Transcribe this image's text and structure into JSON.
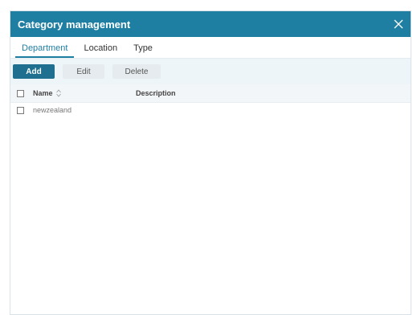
{
  "dialog": {
    "title": "Category management",
    "close_icon": "close-icon"
  },
  "tabs": [
    {
      "label": "Department",
      "active": true
    },
    {
      "label": "Location",
      "active": false
    },
    {
      "label": "Type",
      "active": false
    }
  ],
  "toolbar": {
    "add_label": "Add",
    "edit_label": "Edit",
    "delete_label": "Delete"
  },
  "grid": {
    "columns": {
      "name": "Name",
      "description": "Description"
    },
    "sort_icon": "sort-icon",
    "rows": [
      {
        "name": "newzealand",
        "description": ""
      }
    ]
  },
  "colors": {
    "accent": "#1f7fa3",
    "primary_button": "#1f6f90",
    "toolbar_background": "#eef5f9"
  }
}
